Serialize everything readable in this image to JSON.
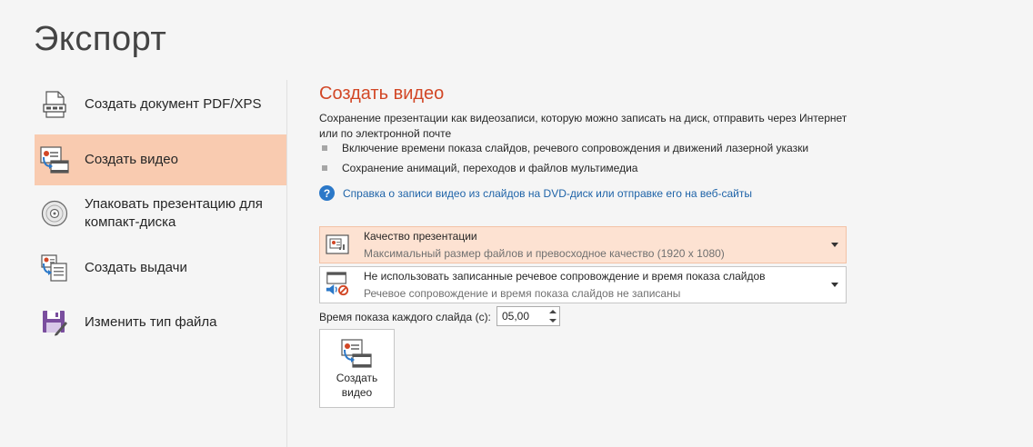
{
  "page": {
    "title": "Экспорт"
  },
  "nav": {
    "items": [
      {
        "label": "Создать документ PDF/XPS",
        "icon": "pdf-document-icon"
      },
      {
        "label": "Создать видео",
        "icon": "video-slide-icon",
        "selected": true
      },
      {
        "label": "Упаковать презентацию для компакт-диска",
        "icon": "cd-disc-icon"
      },
      {
        "label": "Создать выдачи",
        "icon": "handouts-icon"
      },
      {
        "label": "Изменить тип файла",
        "icon": "save-as-icon"
      }
    ]
  },
  "main": {
    "title": "Создать видео",
    "description": "Сохранение презентации как видеозаписи, которую можно записать на диск, отправить через Интернет или по электронной почте",
    "bullets": [
      "Включение времени показа слайдов, речевого сопровождения и движений лазерной указки",
      "Сохранение анимаций, переходов и файлов мультимедиа"
    ],
    "help_link": "Справка о записи видео из слайдов на DVD-диск или отправке его на веб-сайты",
    "quality_dropdown": {
      "title": "Качество презентации",
      "subtitle": "Максимальный размер файлов и превосходное качество (1920 x 1080)"
    },
    "narration_dropdown": {
      "title": "Не использовать записанные речевое сопровождение и время показа слайдов",
      "subtitle": "Речевое сопровождение и время показа слайдов не записаны"
    },
    "slide_time": {
      "label": "Время показа каждого слайда (с):",
      "value": "05,00"
    },
    "create_button": {
      "label": "Создать видео"
    }
  },
  "colors": {
    "accent": "#d24726",
    "selected_bg": "#f9cbb0",
    "link": "#1e63a8"
  }
}
